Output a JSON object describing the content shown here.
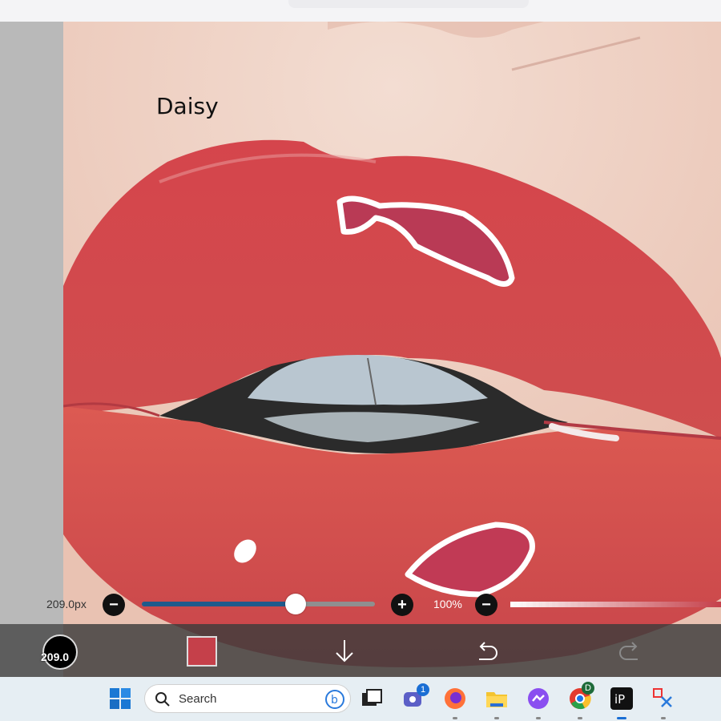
{
  "canvas": {
    "label": "Daisy"
  },
  "brush_size_slider": {
    "value_label": "209.0px",
    "level": 0.66,
    "fill_color": "#1f5a8c",
    "decrease_icon": "minus-icon",
    "increase_icon": "plus-icon"
  },
  "opacity_slider": {
    "value_label": "100%",
    "decrease_icon": "minus-icon"
  },
  "toolbar": {
    "brush_size_label": "209.0",
    "current_color": "#c5404a",
    "download_icon": "arrow-down-icon",
    "undo_icon": "undo-icon",
    "redo_icon": "redo-icon"
  },
  "taskbar": {
    "search_placeholder": "Search",
    "teams_badge": "1",
    "chrome_profile_badge": "D",
    "apps": [
      "start-icon",
      "bing-icon",
      "task-view-icon",
      "teams-icon",
      "firefox-icon",
      "file-explorer-icon",
      "messenger-icon",
      "chrome-icon",
      "ibis-paint-icon",
      "snipping-tool-icon"
    ]
  }
}
